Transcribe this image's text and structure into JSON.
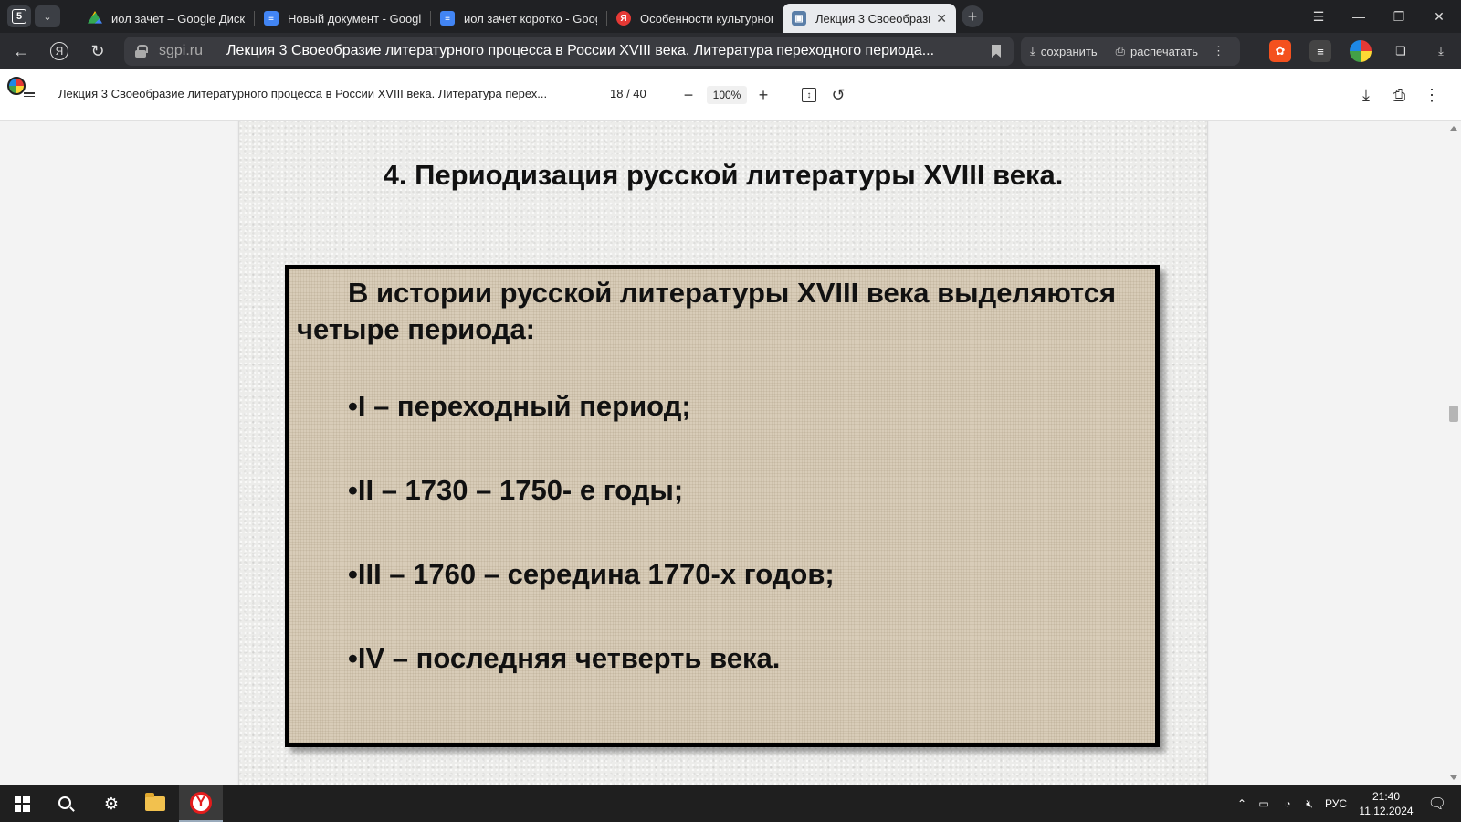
{
  "tabs": {
    "count": "5",
    "items": [
      {
        "title": "иол зачет – Google Диск",
        "icon": "google-drive-icon"
      },
      {
        "title": "Новый документ - Google",
        "icon": "google-docs-icon"
      },
      {
        "title": "иол зачет коротко - Goog",
        "icon": "google-docs-icon"
      },
      {
        "title": "Особенности культурног",
        "icon": "yandex-icon"
      },
      {
        "title": "Лекция 3 Своеобразие",
        "icon": "pdf-viewer-icon"
      }
    ]
  },
  "address": {
    "domain": "sgpi.ru",
    "page_title": "Лекция 3 Своеобразие литературного процесса в России XVIII века. Литература переходного периода...",
    "save_label": "сохранить",
    "print_label": "распечатать"
  },
  "pdf": {
    "doc_title": "Лекция 3 Своеобразие литературного процесса в России XVIII века. Литература перех...",
    "page_current": "18",
    "page_total": "40",
    "page_display": "18 / 40",
    "zoom": "100%"
  },
  "slide": {
    "title": "4. Периодизация русской литературы XVIII века.",
    "intro": "В истории  русской литературы XVIII века выделяются четыре периода:",
    "items": [
      "•I –  переходный период;",
      "•II – 1730 – 1750- е годы;",
      "•III – 1760 – середина 1770-х годов;",
      "•IV – последняя четверть века."
    ]
  },
  "taskbar": {
    "language": "РУС",
    "time": "21:40",
    "date": "11.12.2024"
  },
  "colors": {
    "tabstrip_bg": "#202124",
    "addrbar_bg": "#2b2c30",
    "slide_box_bg": "#d8ccb8",
    "taskbar_bg": "#1f1f1f"
  }
}
